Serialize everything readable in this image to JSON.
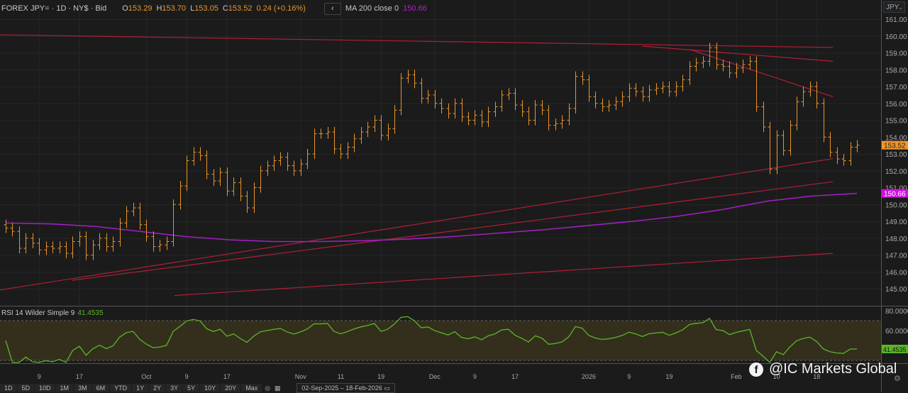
{
  "header": {
    "symbol": "FOREX JPY= · 1D · NY$ · Bid",
    "o_label": "O",
    "o": "153.29",
    "h_label": "H",
    "h": "153.70",
    "l_label": "L",
    "l": "153.05",
    "c_label": "C",
    "c": "153.52",
    "change": "0.24 (+0.16%)",
    "back_icon": "‹",
    "ma_label": "MA 200 close 0",
    "ma_value": "150.66",
    "currency": "JPY"
  },
  "rsi": {
    "label": "RSI 14 Wilder Simple 9",
    "value": "41.4535"
  },
  "watermark": "@IC Markets Global",
  "toolbar": {
    "ranges": [
      "1D",
      "5D",
      "10D",
      "1M",
      "3M",
      "6M",
      "YTD",
      "1Y",
      "2Y",
      "3Y",
      "5Y",
      "10Y",
      "20Y",
      "Max"
    ],
    "date_range": "02-Sep-2025  –  18-Feb-2026"
  },
  "colors": {
    "bar": "#e8942a",
    "trend": "#c0203a",
    "ma": "#a020c0",
    "rsi": "#5ab52a",
    "price_tag": "#f0962a",
    "ma_tag": "#d010e0"
  },
  "chart_data": {
    "type": "ohlc",
    "title": "FOREX JPY= 1D",
    "y_ticks": [
      "161.00",
      "160.00",
      "159.00",
      "158.00",
      "157.00",
      "156.00",
      "155.00",
      "154.00",
      "153.00",
      "152.00",
      "151.00",
      "150.00",
      "149.00",
      "148.00",
      "147.00",
      "146.00",
      "145.00"
    ],
    "ylim": [
      145,
      161
    ],
    "rsi_ticks": [
      "80.0000",
      "60.0000"
    ],
    "rsi_ylim": [
      30,
      80
    ],
    "last_price": "153.52",
    "ma_last": "150.66",
    "x_labels": [
      {
        "label": "9",
        "at": 5
      },
      {
        "label": "17",
        "at": 11
      },
      {
        "label": "Oct",
        "at": 21
      },
      {
        "label": "9",
        "at": 27
      },
      {
        "label": "17",
        "at": 33
      },
      {
        "label": "Nov",
        "at": 44
      },
      {
        "label": "11",
        "at": 50
      },
      {
        "label": "19",
        "at": 56
      },
      {
        "label": "Dec",
        "at": 64
      },
      {
        "label": "9",
        "at": 70
      },
      {
        "label": "17",
        "at": 76
      },
      {
        "label": "2026",
        "at": 87
      },
      {
        "label": "9",
        "at": 93
      },
      {
        "label": "19",
        "at": 99
      },
      {
        "label": "Feb",
        "at": 109
      },
      {
        "label": "10",
        "at": 115
      },
      {
        "label": "18",
        "at": 121
      }
    ],
    "closes": [
      148.6,
      148.4,
      147.4,
      148.0,
      147.7,
      147.3,
      147.5,
      147.4,
      147.5,
      147.1,
      147.8,
      148.1,
      147.0,
      147.6,
      148.0,
      147.5,
      147.8,
      148.9,
      149.6,
      149.8,
      148.8,
      148.1,
      147.5,
      147.6,
      147.8,
      150.0,
      151.1,
      152.6,
      153.1,
      152.9,
      151.8,
      151.4,
      151.9,
      150.8,
      151.3,
      150.5,
      149.8,
      151.0,
      152.0,
      152.3,
      152.6,
      152.8,
      152.3,
      152.0,
      152.4,
      153.0,
      154.2,
      154.2,
      154.3,
      153.3,
      153.0,
      153.4,
      153.9,
      154.3,
      154.6,
      155.0,
      154.1,
      154.5,
      155.6,
      157.5,
      157.7,
      157.2,
      156.3,
      156.5,
      156.0,
      155.7,
      155.4,
      156.0,
      155.2,
      155.0,
      155.3,
      154.9,
      155.5,
      155.8,
      156.5,
      156.6,
      155.9,
      155.5,
      155.0,
      155.9,
      155.6,
      154.7,
      154.8,
      155.0,
      155.7,
      157.6,
      157.4,
      156.4,
      156.0,
      155.8,
      155.9,
      156.1,
      156.4,
      156.9,
      156.7,
      156.4,
      156.8,
      156.9,
      157.0,
      156.7,
      157.0,
      157.4,
      158.2,
      158.4,
      158.5,
      159.3,
      158.3,
      158.2,
      157.8,
      158.1,
      158.3,
      158.5,
      155.8,
      154.6,
      152.1,
      154.1,
      153.2,
      154.7,
      156.1,
      156.7,
      157.0,
      156.0,
      154.0,
      153.1,
      152.7,
      152.6,
      153.4,
      153.52
    ],
    "ma200": [
      148.9,
      148.85,
      148.7,
      148.4,
      148.1,
      147.9,
      147.8,
      147.8,
      147.85,
      147.95,
      148.1,
      148.3,
      148.5,
      148.75,
      149.0,
      149.3,
      149.7,
      150.2,
      150.5,
      150.66
    ],
    "trendlines": [
      {
        "from": [
          -0.8,
          160.07
        ],
        "to": [
          123.4,
          159.32
        ]
      },
      {
        "from": [
          95.0,
          159.4
        ],
        "to": [
          123.4,
          158.5
        ]
      },
      {
        "from": [
          102.1,
          159.2
        ],
        "to": [
          123.4,
          156.4
        ]
      },
      {
        "from": [
          -0.8,
          144.93
        ],
        "to": [
          123.4,
          152.72
        ]
      },
      {
        "from": [
          9.9,
          145.5
        ],
        "to": [
          123.4,
          151.35
        ]
      },
      {
        "from": [
          25.2,
          144.6
        ],
        "to": [
          123.4,
          147.1
        ]
      }
    ],
    "rsi_bands": [
      70,
      30
    ]
  }
}
